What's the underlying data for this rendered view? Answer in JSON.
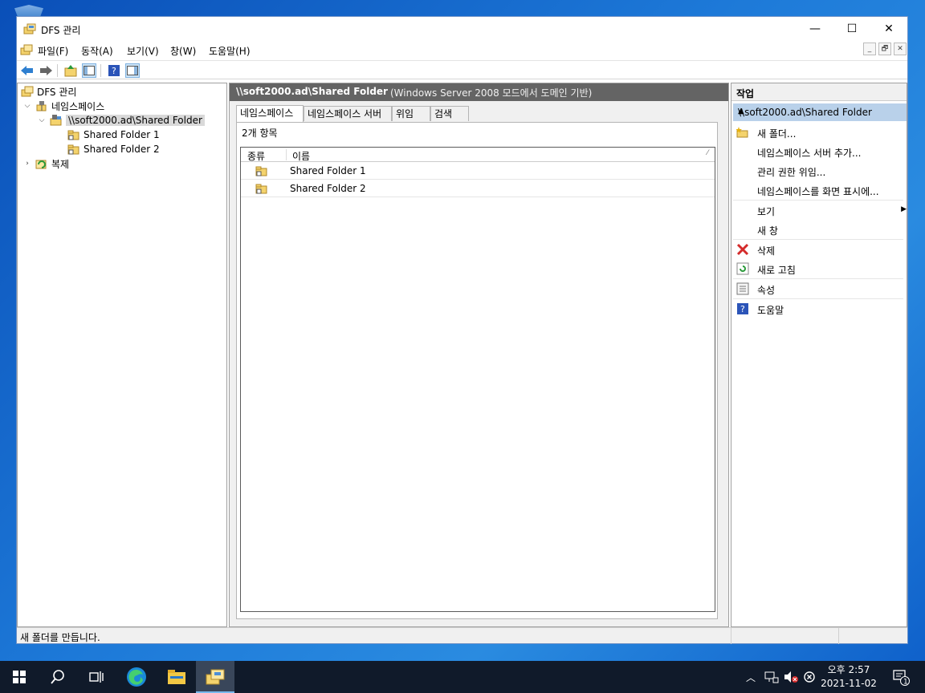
{
  "window": {
    "title": "DFS 관리",
    "controls": {
      "minimize": "—",
      "maximize": "☐",
      "close": "✕"
    }
  },
  "menu": [
    "파일(F)",
    "동작(A)",
    "보기(V)",
    "창(W)",
    "도움말(H)"
  ],
  "mdi_controls": [
    "_",
    "🗗",
    "✕"
  ],
  "toolbar": {
    "buttons": [
      "back-arrow-icon",
      "forward-arrow-icon",
      "up-folder-icon",
      "show-hide-tree-icon",
      "help-icon",
      "show-hide-action-pane-icon"
    ]
  },
  "tree": {
    "root": "DFS 관리",
    "namespaces": "네임스페이스",
    "namespace_path": "\\\\soft2000.ad\\Shared Folder",
    "children": [
      "Shared Folder 1",
      "Shared Folder 2"
    ],
    "replication": "복제"
  },
  "main": {
    "header_path": "\\\\soft2000.ad\\Shared Folder",
    "header_mode": "(Windows Server 2008 모드에서 도메인 기반)",
    "tabs": [
      "네임스페이스",
      "네임스페이스 서버",
      "위임",
      "검색"
    ],
    "active_tab": "네임스페이스",
    "item_count": "2개 항목",
    "columns": {
      "type": "종류",
      "name": "이름"
    },
    "rows": [
      {
        "name": "Shared Folder 1"
      },
      {
        "name": "Shared Folder 2"
      }
    ]
  },
  "actions": {
    "header": "작업",
    "section": "\\\\soft2000.ad\\Shared Folder",
    "items": [
      {
        "label": "새 폴더...",
        "icon": "new-folder-icon"
      },
      {
        "label": "네임스페이스 서버 추가...",
        "icon": ""
      },
      {
        "label": "관리 권한 위임...",
        "icon": ""
      },
      {
        "label": "네임스페이스를 화면 표시에...",
        "icon": ""
      },
      {
        "label": "보기",
        "icon": "",
        "submenu": true
      },
      {
        "label": "새 창",
        "icon": ""
      },
      {
        "label": "삭제",
        "icon": "delete-icon"
      },
      {
        "label": "새로 고침",
        "icon": "refresh-icon"
      },
      {
        "label": "속성",
        "icon": "properties-icon"
      },
      {
        "label": "도움말",
        "icon": "help-icon"
      }
    ]
  },
  "status": "새 폴더를 만듭니다.",
  "taskbar": {
    "apps": [
      "start-icon",
      "search-icon",
      "task-view-icon",
      "edge-icon",
      "file-explorer-icon",
      "dfs-management-icon"
    ],
    "clock_time": "오후 2:57",
    "clock_date": "2021-11-02",
    "notification_count": "1"
  },
  "colors": {
    "selection": "#b9d1ea",
    "header_dark": "#646464",
    "desktop": "#1d79d8",
    "taskbar": "#101a2a"
  }
}
